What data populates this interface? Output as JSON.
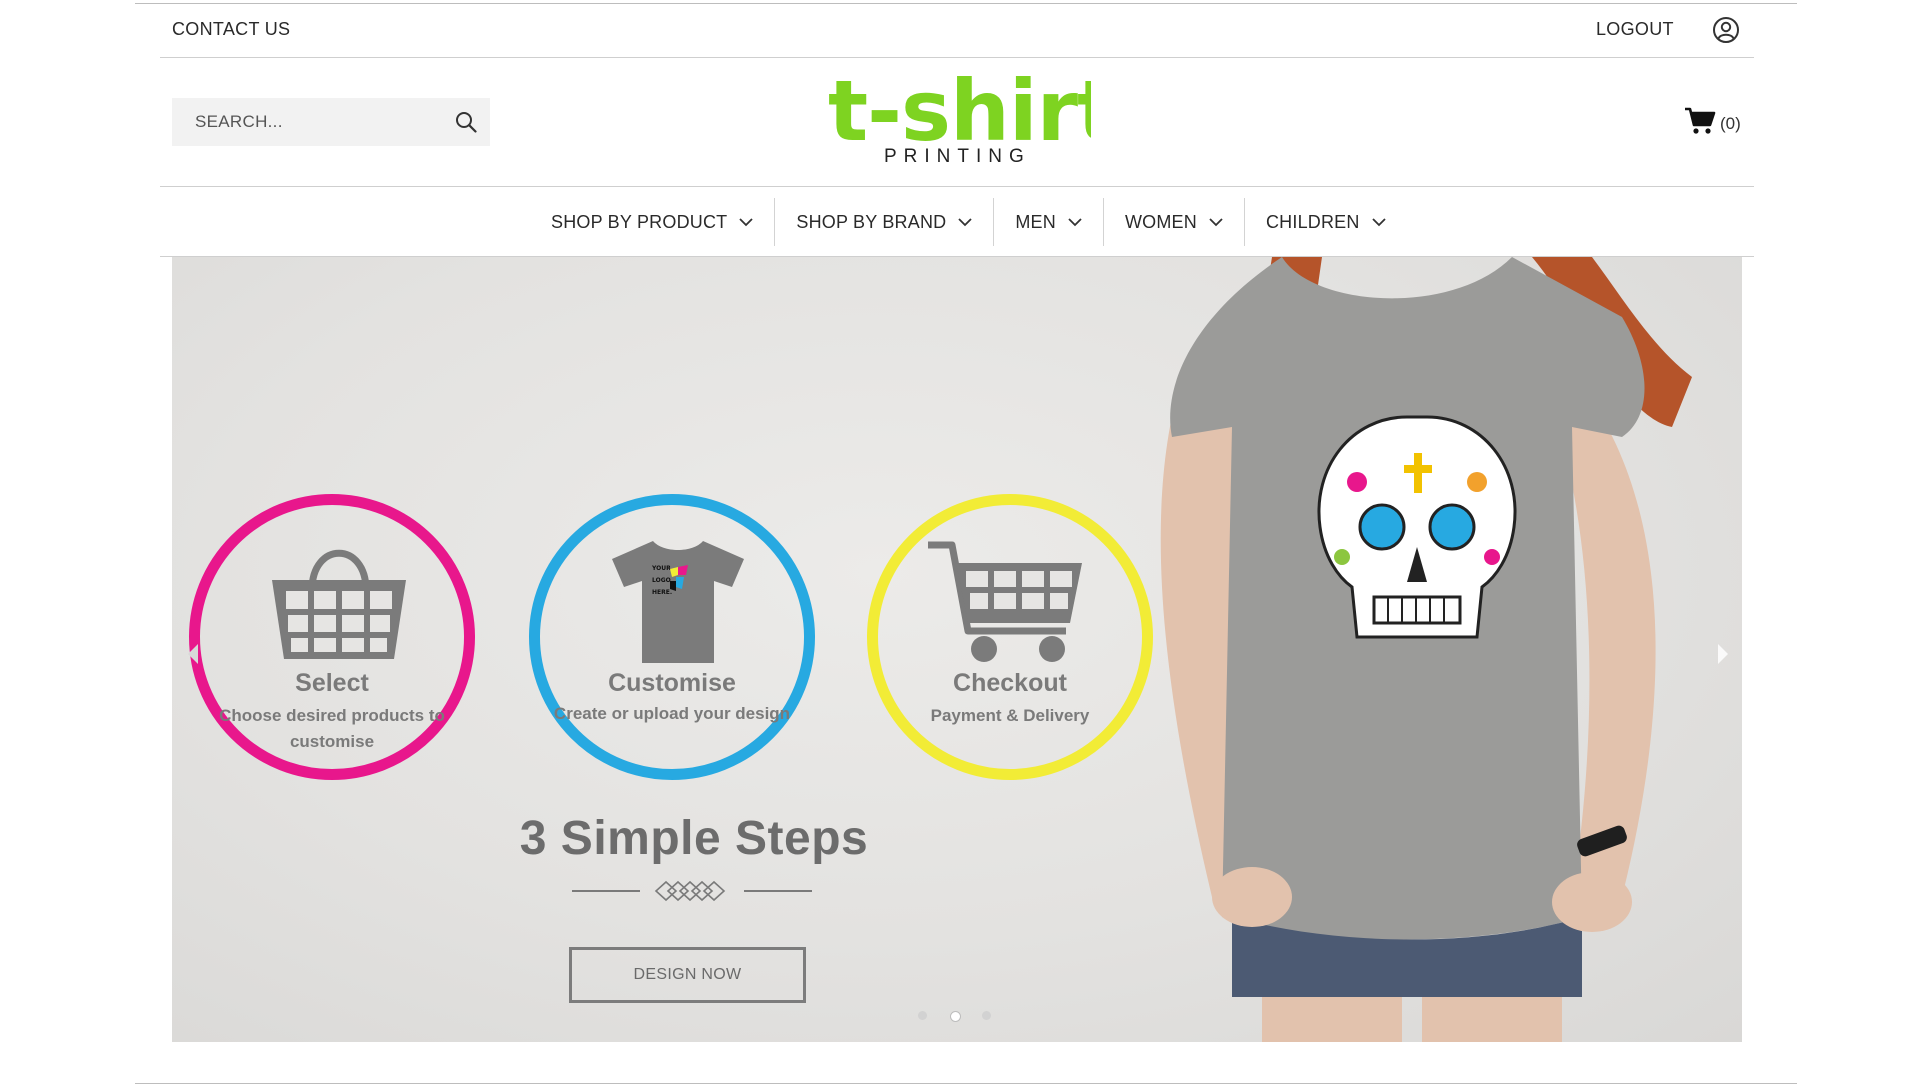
{
  "topbar": {
    "contact_label": "CONTACT US",
    "logout_label": "LOGOUT",
    "account_icon": "user-circle-icon"
  },
  "search": {
    "placeholder": "SEARCH...",
    "icon": "search-icon"
  },
  "logo": {
    "main_text": "t-shirt",
    "sub_text": "PRINTING",
    "color": "#7ed321"
  },
  "cart": {
    "icon": "cart-icon",
    "count_label": "(0)"
  },
  "nav": {
    "items": [
      {
        "label": "SHOP BY PRODUCT"
      },
      {
        "label": "SHOP BY BRAND"
      },
      {
        "label": "MEN"
      },
      {
        "label": "WOMEN"
      },
      {
        "label": "CHILDREN"
      }
    ]
  },
  "hero": {
    "steps": [
      {
        "title": "Select",
        "description": "Choose desired products to customise",
        "ring_color": "#e8178c"
      },
      {
        "title": "Customise",
        "description": "Create or upload your design",
        "ring_color": "#27a9e1",
        "tshirt_text": "YOUR LOGO HERE."
      },
      {
        "title": "Checkout",
        "description": "Payment & Delivery",
        "ring_color": "#f2ec36"
      }
    ],
    "heading": "3 Simple Steps",
    "button_label": "DESIGN NOW",
    "slides_total": 3,
    "active_slide": 2
  }
}
